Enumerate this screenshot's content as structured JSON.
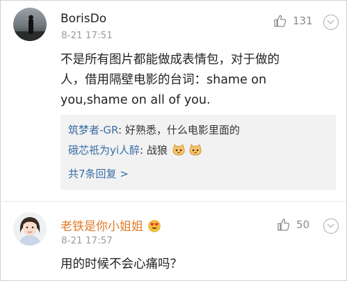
{
  "comments": [
    {
      "username": "BorisDo",
      "time": "8-21 17:51",
      "likes": "131",
      "text_line1": "不是所有图片都能做成表情包，对于做的",
      "text_line2": "人，借用隔壁电影的台词：shame on",
      "text_line3": "you,shame on all of you.",
      "replies": [
        {
          "user": "筑梦者-GR",
          "separator": ": ",
          "text": "好熟悉，什么电影里面的"
        },
        {
          "user": "硪芯祇为yi人醉",
          "separator": ": ",
          "text": "战狼"
        }
      ],
      "reply_count": "共7条回复 >"
    },
    {
      "username": "老铁是你小姐姐",
      "time": "8-21 17:57",
      "likes": "50",
      "text_line1": "用的时候不会心痛吗？"
    }
  ],
  "colors": {
    "link": "#3a6ea5",
    "highlight_name": "#e07b2a",
    "muted": "#9a9a9a",
    "reply_bg": "#f2f2f2"
  },
  "icons": [
    "thumbs-up-icon",
    "chevron-down-icon",
    "cat-emoji-icon",
    "heart-eyes-emoji-icon"
  ]
}
